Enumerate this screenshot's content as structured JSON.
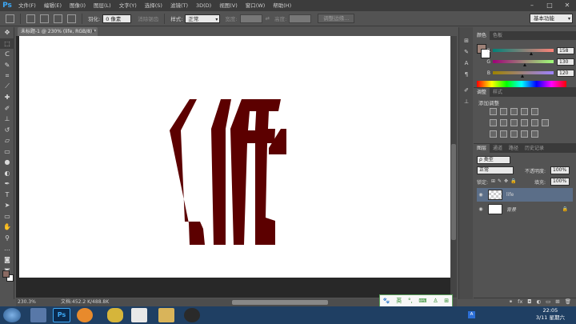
{
  "app": {
    "name": "Ps"
  },
  "menu": [
    "文件(F)",
    "编辑(E)",
    "图像(I)",
    "图层(L)",
    "文字(Y)",
    "选择(S)",
    "滤镜(T)",
    "3D(D)",
    "视图(V)",
    "窗口(W)",
    "帮助(H)"
  ],
  "options": {
    "feather_label": "羽化:",
    "feather_value": "0 像素",
    "antialias_label": "消除锯齿",
    "style_label": "样式:",
    "style_value": "正常",
    "width_label": "宽度:",
    "height_label": "高度:",
    "refine_button": "调整边缘...",
    "workspace": "基本功能"
  },
  "document": {
    "tab_title": "未标题-1 @ 230% (life, RGB/8) *",
    "zoom": "230.3%",
    "doc_info": "文档:452.2 K/488.8K"
  },
  "color_panel": {
    "tabs": [
      "颜色",
      "色板"
    ],
    "foreground": "#9e8278",
    "r_label": "R",
    "r_value": "158",
    "g_label": "G",
    "g_value": "130",
    "b_label": "B",
    "b_value": "120"
  },
  "adjust_panel": {
    "tabs": [
      "调整",
      "样式"
    ],
    "title": "添加调整"
  },
  "layers_panel": {
    "tabs": [
      "图层",
      "通道",
      "路径",
      "历史记录"
    ],
    "kind_value": "ρ 类型",
    "blend_mode": "正常",
    "opacity_label": "不透明度:",
    "opacity_value": "100%",
    "lock_label": "锁定:",
    "fill_label": "填充:",
    "fill_value": "100%",
    "layers": [
      {
        "name": "life",
        "selected": true
      },
      {
        "name": "背景",
        "selected": false
      }
    ]
  },
  "ime": {
    "label": "英"
  },
  "taskbar": {
    "time": "22:05",
    "date": "3/11 星期六"
  },
  "canvas_text": {
    "word": "LIFE",
    "color": "#5c0000"
  }
}
